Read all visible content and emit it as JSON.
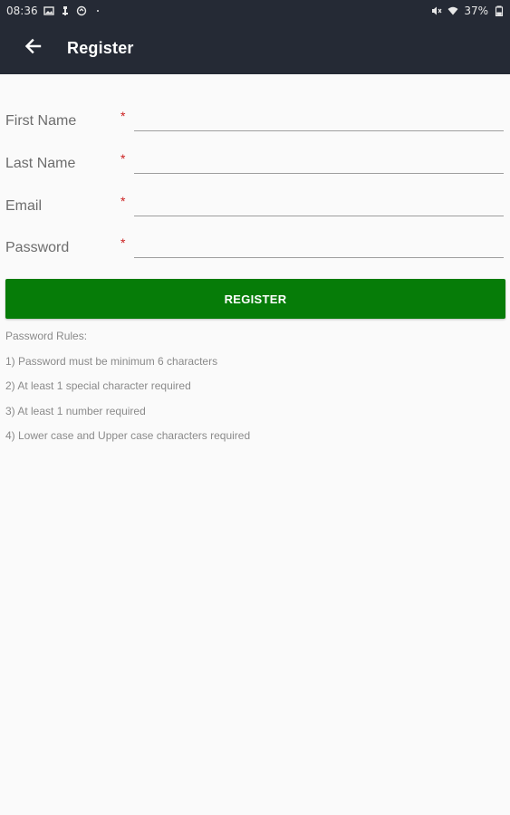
{
  "status_bar": {
    "time": "08:36",
    "battery": "37%",
    "icons": [
      "gallery-icon",
      "usb-icon",
      "sync-icon",
      "dot-icon",
      "mute-icon",
      "wifi-icon",
      "battery-icon"
    ]
  },
  "app_bar": {
    "title": "Register",
    "back_icon": "arrow-left-icon"
  },
  "form": {
    "fields": [
      {
        "label": "First Name",
        "required_marker": "*",
        "value": ""
      },
      {
        "label": "Last Name",
        "required_marker": "*",
        "value": ""
      },
      {
        "label": "Email",
        "required_marker": "*",
        "value": ""
      },
      {
        "label": "Password",
        "required_marker": "*",
        "value": ""
      }
    ],
    "submit_label": "REGISTER"
  },
  "password_rules": {
    "heading": "Password Rules:",
    "items": [
      "1) Password must be minimum 6 characters",
      "2) At least 1 special character required",
      "3) At least 1 number required",
      "4) Lower case and Upper case characters required"
    ]
  },
  "colors": {
    "app_bar_bg": "#252a35",
    "primary_button": "#067c08",
    "required_marker": "#cc2020",
    "background": "#fafafa"
  }
}
